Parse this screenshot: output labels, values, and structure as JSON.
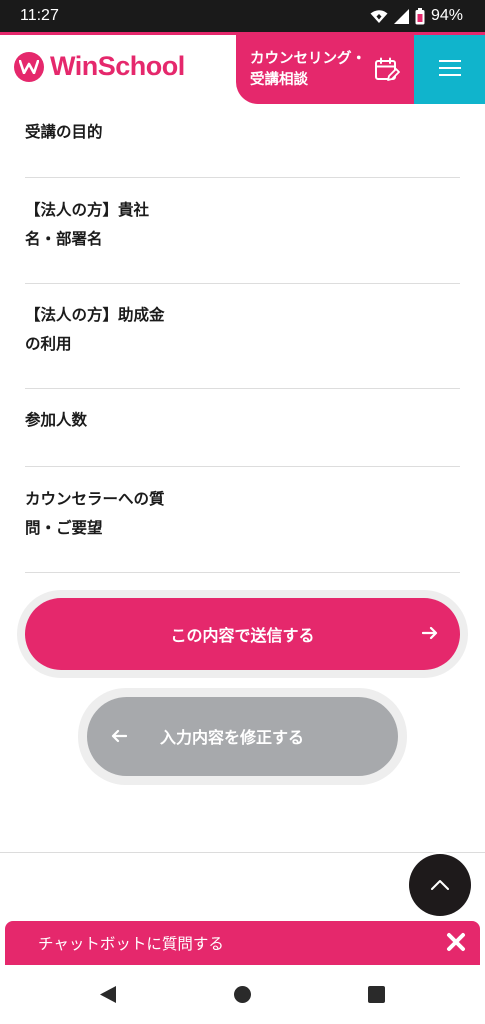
{
  "status_bar": {
    "time": "11:27",
    "battery": "94%",
    "icons": [
      "wifi-icon",
      "signal-icon",
      "battery-icon"
    ]
  },
  "header": {
    "logo_text": "WinSchool",
    "counsel_button_label": "カウンセリング・受講相談",
    "icons": [
      "logo-mark-icon",
      "calendar-edit-icon",
      "hamburger-menu-icon"
    ]
  },
  "form": {
    "rows": [
      {
        "label": "受講の目的"
      },
      {
        "label": "【法人の方】貴社名・部署名"
      },
      {
        "label": "【法人の方】助成金の利用"
      },
      {
        "label": "参加人数"
      },
      {
        "label": "カウンセラーへの質問・ご要望"
      }
    ]
  },
  "actions": {
    "submit_label": "この内容で送信する",
    "back_label": "入力内容を修正する",
    "icons": [
      "arrow-right-icon",
      "arrow-left-icon"
    ]
  },
  "back_to_top": {
    "icon": "chevron-up-icon"
  },
  "chatbot": {
    "label": "チャットボットに質問する",
    "icon": "close-icon"
  },
  "colors": {
    "brand_pink": "#e5286c",
    "menu_cyan": "#10b4cc",
    "secondary_gray": "#a7a9ac",
    "dark": "#1e1a1b"
  }
}
